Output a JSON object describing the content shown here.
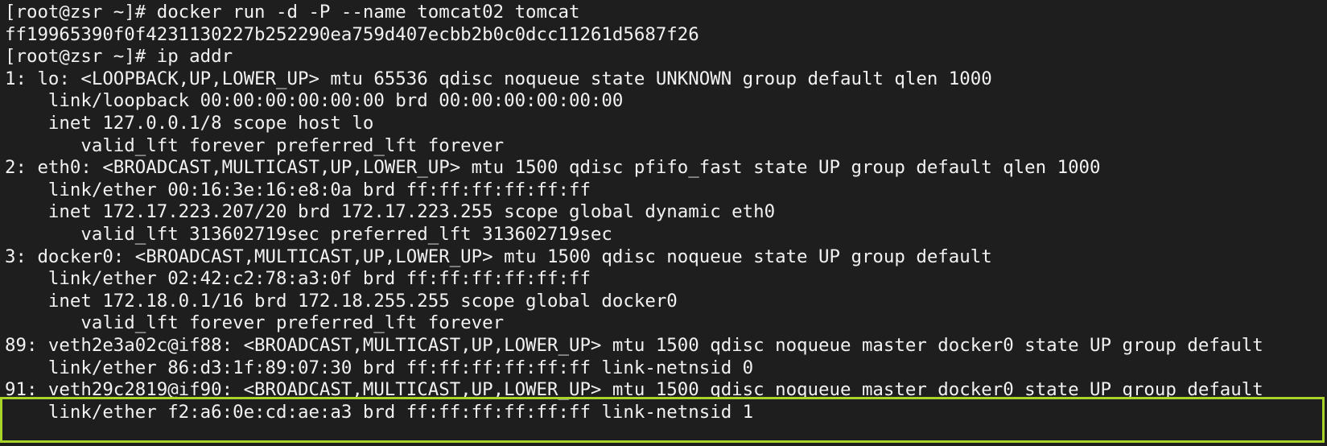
{
  "terminal": {
    "lines": [
      "[root@zsr ~]# docker run -d -P --name tomcat02 tomcat",
      "ff19965390f0f4231130227b252290ea759d407ecbb2b0c0dcc11261d5687f26",
      "[root@zsr ~]# ip addr",
      "1: lo: <LOOPBACK,UP,LOWER_UP> mtu 65536 qdisc noqueue state UNKNOWN group default qlen 1000",
      "    link/loopback 00:00:00:00:00:00 brd 00:00:00:00:00:00",
      "    inet 127.0.0.1/8 scope host lo",
      "       valid_lft forever preferred_lft forever",
      "2: eth0: <BROADCAST,MULTICAST,UP,LOWER_UP> mtu 1500 qdisc pfifo_fast state UP group default qlen 1000",
      "    link/ether 00:16:3e:16:e8:0a brd ff:ff:ff:ff:ff:ff",
      "    inet 172.17.223.207/20 brd 172.17.223.255 scope global dynamic eth0",
      "       valid_lft 313602719sec preferred_lft 313602719sec",
      "3: docker0: <BROADCAST,MULTICAST,UP,LOWER_UP> mtu 1500 qdisc noqueue state UP group default",
      "    link/ether 02:42:c2:78:a3:0f brd ff:ff:ff:ff:ff:ff",
      "    inet 172.18.0.1/16 brd 172.18.255.255 scope global docker0",
      "       valid_lft forever preferred_lft forever",
      "89: veth2e3a02c@if88: <BROADCAST,MULTICAST,UP,LOWER_UP> mtu 1500 qdisc noqueue master docker0 state UP group default",
      "    link/ether 86:d3:1f:89:07:30 brd ff:ff:ff:ff:ff:ff link-netnsid 0",
      "91: veth29c2819@if90: <BROADCAST,MULTICAST,UP,LOWER_UP> mtu 1500 qdisc noqueue master docker0 state UP group default",
      "    link/ether f2:a6:0e:cd:ae:a3 brd ff:ff:ff:ff:ff:ff link-netnsid 1"
    ]
  },
  "colors": {
    "background": "#1e1e1e",
    "text": "#f2f2f2",
    "highlight": "#a8d42a"
  }
}
